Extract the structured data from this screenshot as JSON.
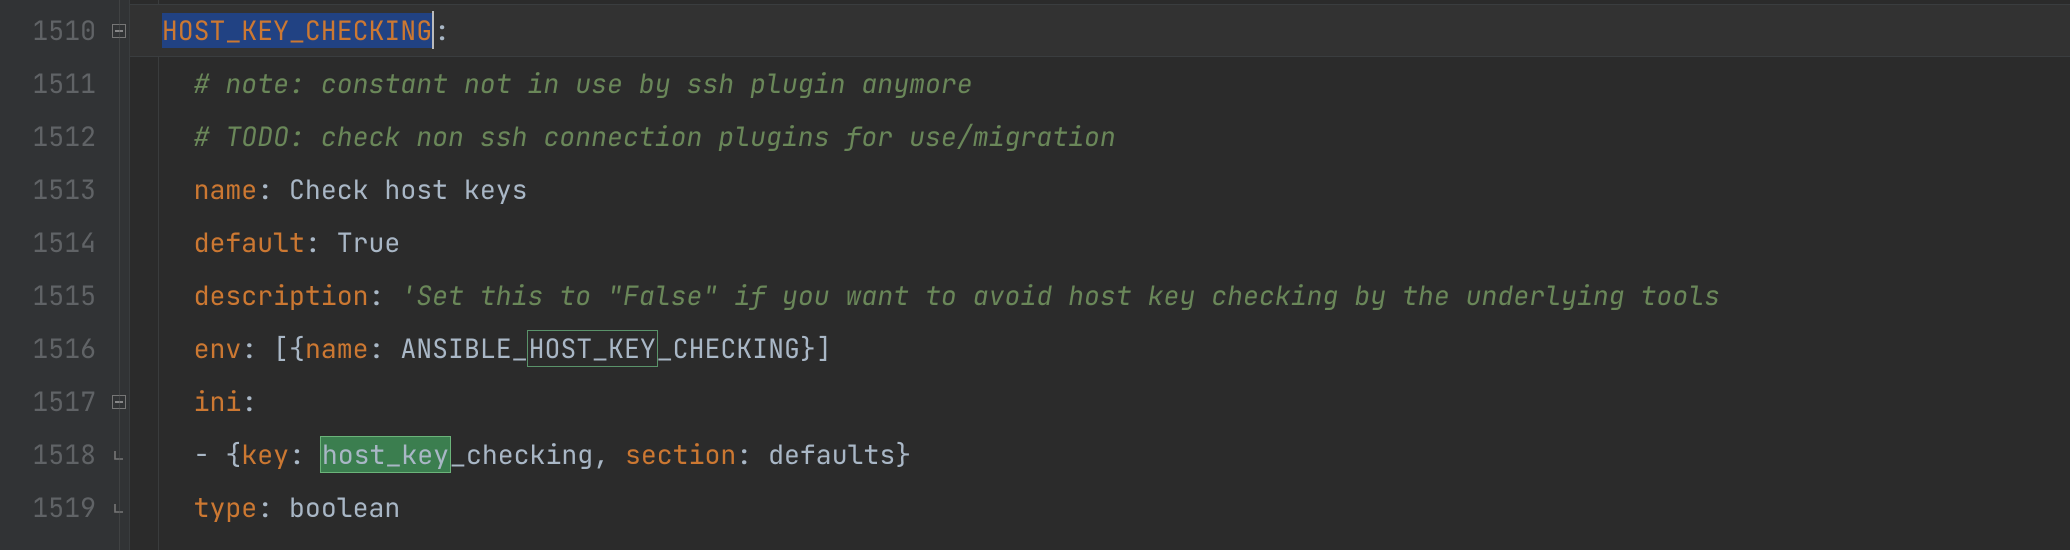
{
  "line_numbers": [
    "1510",
    "1511",
    "1512",
    "1513",
    "1514",
    "1515",
    "1516",
    "1517",
    "1518",
    "1519"
  ],
  "fold_markers": {
    "1510": "minus",
    "1517": "minus",
    "1518": "end",
    "1519": "end"
  },
  "indent": "  ",
  "indent2": "    ",
  "row0": {
    "key": "HOST_KEY_CHECKING",
    "colon": ":"
  },
  "row1": {
    "text": "# note: constant not in use by ssh plugin anymore"
  },
  "row2": {
    "text": "# TODO: check non ssh connection plugins for use/migration"
  },
  "row3": {
    "key": "name",
    "colon": ": ",
    "value": "Check host keys"
  },
  "row4": {
    "key": "default",
    "colon": ": ",
    "value": "True"
  },
  "row5": {
    "key": "description",
    "colon": ": ",
    "value": "'Set this to \"False\" if you want to avoid host key checking by the underlying tools "
  },
  "row6": {
    "key": "env",
    "colon": ": ",
    "pre": "[{",
    "innerkey": "name",
    "innercolon": ": ",
    "v_a": "ANSIBLE_",
    "v_b": "HOST_KEY",
    "v_c": "_CHECKING",
    "post": "}]"
  },
  "row7": {
    "key": "ini",
    "colon": ":"
  },
  "row8": {
    "dash": "- ",
    "open": "{",
    "k1": "key",
    "c1": ": ",
    "v1a": "host_key",
    "v1b": "_checking",
    "comma": ", ",
    "k2": "section",
    "c2": ": ",
    "v2": "defaults",
    "close": "}"
  },
  "row9": {
    "key": "type",
    "colon": ": ",
    "value": "boolean"
  }
}
